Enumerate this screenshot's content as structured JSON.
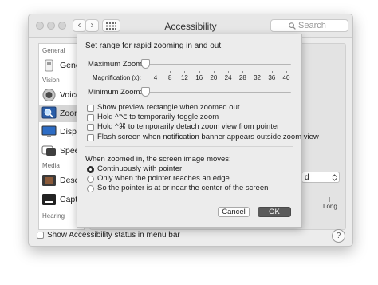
{
  "window": {
    "title": "Accessibility",
    "search_placeholder": "Search",
    "back_glyph": "‹",
    "forward_glyph": "›",
    "grid_icon": "grid-icon",
    "help_label": "?"
  },
  "sidebar": {
    "sections": [
      "General",
      "Vision",
      "Media",
      "Hearing"
    ],
    "items": [
      {
        "label": "General",
        "icon": "general-icon"
      },
      {
        "label": "VoiceOver",
        "icon": "voiceover-icon"
      },
      {
        "label": "Zoom",
        "icon": "zoom-icon",
        "selected": true
      },
      {
        "label": "Display",
        "icon": "display-icon"
      },
      {
        "label": "Speech",
        "icon": "speech-icon"
      },
      {
        "label": "Descriptions",
        "icon": "descriptions-icon"
      },
      {
        "label": "Captions",
        "icon": "captions-icon"
      }
    ]
  },
  "background_panel": {
    "popup_value": "d",
    "slider_end_label": "Long"
  },
  "bottom_bar": {
    "show_status_label": "Show Accessibility status in menu bar",
    "show_status_checked": false
  },
  "sheet": {
    "heading": "Set range for rapid zooming in and out:",
    "max_zoom_label": "Maximum Zoom:",
    "magnification_label": "Magnification (x):",
    "magnification_ticks": [
      "4",
      "8",
      "12",
      "16",
      "20",
      "24",
      "28",
      "32",
      "36",
      "40"
    ],
    "min_zoom_label": "Minimum Zoom:",
    "max_zoom_value": 1,
    "min_zoom_value": 1,
    "checkboxes": [
      {
        "label": "Show preview rectangle when zoomed out",
        "checked": false
      },
      {
        "label": "Hold ^⌥ to temporarily toggle zoom",
        "checked": false
      },
      {
        "label": "Hold ^⌘ to temporarily detach zoom view from pointer",
        "checked": false
      },
      {
        "label": "Flash screen when notification banner appears outside zoom view",
        "checked": false
      }
    ],
    "moves_heading": "When zoomed in, the screen image moves:",
    "radios": [
      {
        "label": "Continuously with pointer",
        "selected": true
      },
      {
        "label": "Only when the pointer reaches an edge",
        "selected": false
      },
      {
        "label": "So the pointer is at or near the center of the screen",
        "selected": false
      }
    ],
    "cancel_label": "Cancel",
    "ok_label": "OK"
  }
}
